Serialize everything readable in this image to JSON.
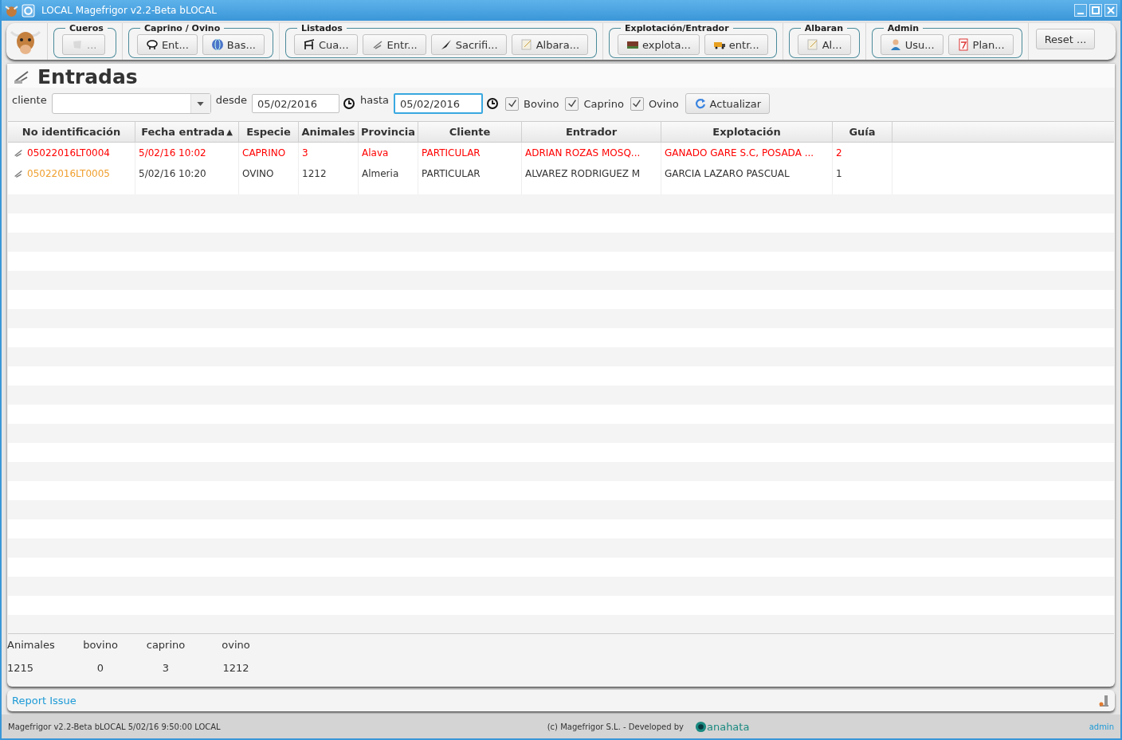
{
  "window": {
    "title": "LOCAL Magefrigor v2.2-Beta bLOCAL"
  },
  "toolbar": {
    "groups": [
      {
        "title": "Cueros",
        "buttons": [
          {
            "label": "...",
            "disabled": true
          }
        ]
      },
      {
        "title": "Caprino / Ovino",
        "buttons": [
          {
            "label": "Ent...",
            "disabled": false
          },
          {
            "label": "Bas...",
            "disabled": false
          }
        ]
      },
      {
        "title": "Listados",
        "buttons": [
          {
            "label": "Cua...",
            "disabled": false
          },
          {
            "label": "Entr...",
            "disabled": false
          },
          {
            "label": "Sacrifi...",
            "disabled": false
          },
          {
            "label": "Albara...",
            "disabled": false
          }
        ]
      },
      {
        "title": "Explotación/Entrador",
        "buttons": [
          {
            "label": "explota...",
            "disabled": false
          },
          {
            "label": "entr...",
            "disabled": false
          }
        ]
      },
      {
        "title": "Albaran",
        "buttons": [
          {
            "label": "Al...",
            "disabled": false
          }
        ]
      },
      {
        "title": "Admin",
        "buttons": [
          {
            "label": "Usu...",
            "disabled": false
          },
          {
            "label": "Plan...",
            "disabled": false
          }
        ]
      }
    ],
    "reset_button": "Reset ..."
  },
  "page": {
    "title": "Entradas"
  },
  "filters": {
    "cliente_label": "cliente",
    "desde_label": "desde",
    "desde_value": "05/02/2016",
    "hasta_label": "hasta",
    "hasta_value": "05/02/2016",
    "checkboxes": [
      {
        "label": "Bovino",
        "checked": true
      },
      {
        "label": "Caprino",
        "checked": true
      },
      {
        "label": "Ovino",
        "checked": true
      }
    ],
    "refresh_button": "Actualizar"
  },
  "table": {
    "columns": [
      {
        "label": "No identificación"
      },
      {
        "label": "Fecha entrada",
        "sort": "▲"
      },
      {
        "label": "Especie"
      },
      {
        "label": "Animales"
      },
      {
        "label": "Provincia"
      },
      {
        "label": "Cliente"
      },
      {
        "label": "Entrador"
      },
      {
        "label": "Explotación"
      },
      {
        "label": "Guía"
      }
    ],
    "rows": [
      {
        "id_cell": {
          "color": "#ff0000"
        },
        "color": "#ff0000",
        "cells": [
          "05022016LT0004",
          "5/02/16 10:02",
          "CAPRINO",
          "3",
          "Alava",
          "PARTICULAR",
          "ADRIAN ROZAS MOSQ...",
          "GANADO GARE S.C, POSADA ...",
          "2"
        ]
      },
      {
        "id_cell": {
          "color": "#f0a030"
        },
        "color": "#333333",
        "cells": [
          "05022016LT0005",
          "5/02/16 10:20",
          "OVINO",
          "1212",
          "Almeria",
          "PARTICULAR",
          "ALVAREZ RODRIGUEZ M",
          "GARCIA LAZARO PASCUAL",
          "1"
        ]
      }
    ]
  },
  "totals": [
    {
      "label": "Animales",
      "value": "1215"
    },
    {
      "label": "bovino",
      "value": "0"
    },
    {
      "label": "caprino",
      "value": "3"
    },
    {
      "label": "ovino",
      "value": "1212"
    }
  ],
  "report_link": "Report Issue",
  "status_bar": {
    "left": "Magefrigor v2.2-Beta bLOCAL 5/02/16 9:50:00 LOCAL",
    "center": "(c)  Magefrigor S.L.  - Developed by",
    "brand": "anahata",
    "user": "admin"
  }
}
